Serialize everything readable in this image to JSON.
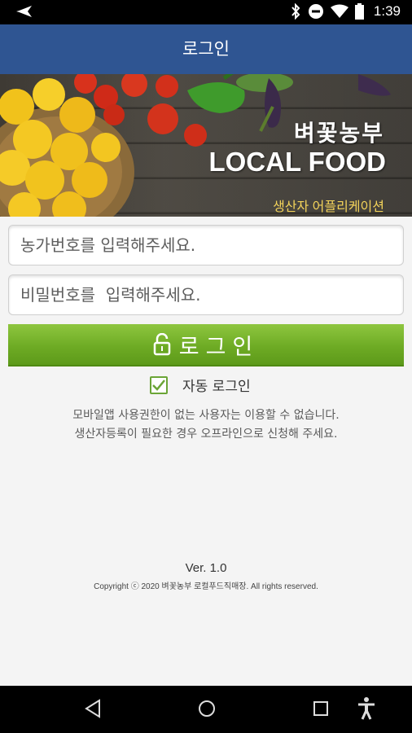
{
  "status_bar": {
    "time": "1:39"
  },
  "header": {
    "title": "로그인"
  },
  "banner": {
    "brand": "벼꽃농부",
    "headline": "LOCAL FOOD",
    "subtitle": "생산자 어플리케이션"
  },
  "form": {
    "farm_number_placeholder": "농가번호를 입력해주세요.",
    "password_placeholder": "비밀번호를  입력해주세요.",
    "login_button": "로그인",
    "auto_login_label": "자동 로그인",
    "auto_login_checked": true
  },
  "notice": {
    "line1": "모바일앱 사용권한이 없는 사용자는 이용할 수 없습니다.",
    "line2": "생산자등록이 필요한 경우 오프라인으로 신청해 주세요."
  },
  "footer": {
    "version": "Ver. 1.0",
    "copyright": "Copyright ⓒ 2020 벼꽃농부 로컬푸드직매장. All rights reserved."
  },
  "colors": {
    "header_bg": "#2f5592",
    "login_button": "#7ab530",
    "subtitle": "#f3d35a"
  },
  "icons": {
    "status_left": "cast-icon",
    "status_right": [
      "bluetooth-icon",
      "do-not-disturb-icon",
      "wifi-icon",
      "battery-icon"
    ],
    "nav": [
      "back-icon",
      "home-icon",
      "recents-icon",
      "accessibility-icon"
    ],
    "login": "unlock-icon",
    "check": "checkmark-icon"
  }
}
